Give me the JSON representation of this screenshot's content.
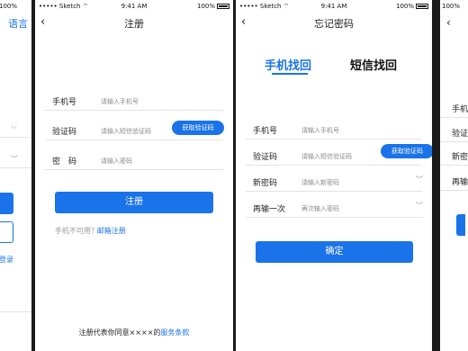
{
  "status": {
    "carrier": "Sketch",
    "time": "9:41 AM",
    "battery": "100%"
  },
  "screen1": {
    "battery": "100%",
    "nav_right": "语言",
    "link_partial": "登录"
  },
  "register": {
    "title": "注册",
    "phone_label": "手机号",
    "phone_placeholder": "请输入手机号",
    "code_label": "验证码",
    "code_placeholder": "请输入短信验证码",
    "get_code_button": "获取验证码",
    "password_label": "密　码",
    "password_placeholder": "请输入密码",
    "submit_button": "注册",
    "alt_prompt": "手机不可用?",
    "alt_link": "邮箱注册",
    "terms_prefix": "注册代表你同意××××的",
    "terms_link": "服务条款"
  },
  "forgot": {
    "title": "忘记密码",
    "tabs": [
      "手机找回",
      "短信找回"
    ],
    "active_tab": "手机找回",
    "phone_label": "手机号",
    "phone_placeholder": "请输入手机号",
    "code_label": "验证码",
    "code_placeholder": "请输入短信验证码",
    "get_code_button": "获取验证码",
    "new_pwd_label": "新密码",
    "new_pwd_placeholder": "请输入新密码",
    "confirm_label": "再输一次",
    "confirm_placeholder": "再次输入密码",
    "submit_button": "确定"
  },
  "screen4": {
    "battery": "100%",
    "labels": [
      "手机号",
      "验证码",
      "新密",
      "再输"
    ]
  },
  "colors": {
    "accent": "#1a73e8",
    "background": "#1b1b1b",
    "screen": "#ffffff"
  },
  "icons": {
    "back": "chevron-left-icon",
    "eye": "eye-closed-icon",
    "wifi": "wifi-icon",
    "battery": "battery-icon",
    "dropdown": "chevron-down-icon"
  }
}
